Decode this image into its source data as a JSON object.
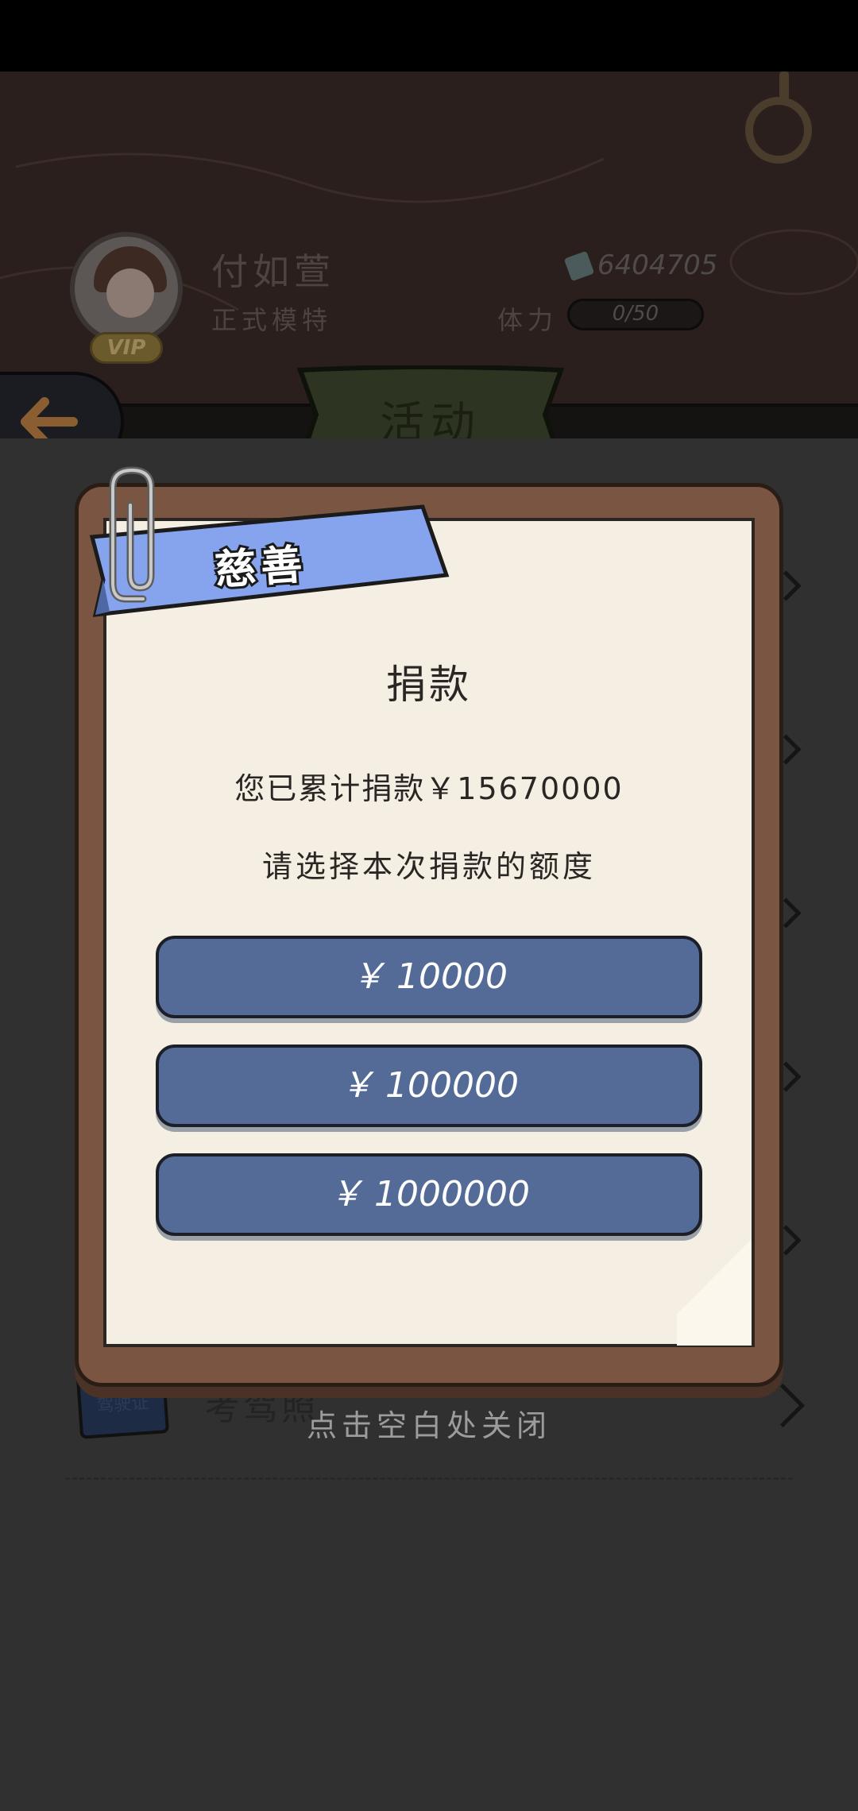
{
  "header": {
    "player_name": "付如萱",
    "player_title": "正式模特",
    "vip_label": "VIP",
    "money": "6404705",
    "stamina_label": "体力",
    "stamina_value": "0/50",
    "stamina_fraction": 0
  },
  "tabs": {
    "active_label": "活动"
  },
  "background_list": {
    "partial_item_label": "考驾照",
    "partial_item_icon_text": "驾驶证"
  },
  "modal": {
    "ribbon_title": "慈善",
    "heading": "捐款",
    "donated_total": "您已累计捐款￥15670000",
    "choose_amount_label": "请选择本次捐款的额度",
    "amount_options": [
      "￥ 10000",
      "￥ 100000",
      "￥ 1000000"
    ]
  },
  "close_hint": "点击空白处关闭",
  "colors": {
    "modal_board": "#7a5542",
    "paper": "#f4efe2",
    "ribbon": "#86a3ee",
    "amount_button": "#536b96",
    "tab_green": "#4b5e31",
    "back_arrow": "#b0743a"
  },
  "icons": {
    "back": "arrow-left-icon",
    "profile": "ring-icon",
    "money": "banknote-icon",
    "clip": "paperclip-icon"
  }
}
